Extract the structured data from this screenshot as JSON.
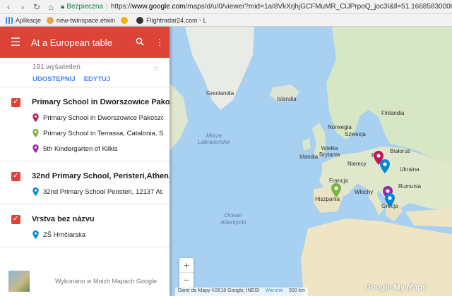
{
  "browser": {
    "secure_label": "Bezpieczna",
    "url_prefix": "https://",
    "url_host": "www.google.com",
    "url_rest": "/maps/d/u/0/viewer?mid=1aI8VkXrjhjGCFMuMR_CiJPrpoQ_joc3I&ll=51.166858300000015%2C19.093899498"
  },
  "bookmarks": [
    {
      "label": "Aplikacje",
      "color": "#5f6368"
    },
    {
      "label": "new-twinspace.etwin",
      "color": "#e8a33d"
    },
    {
      "label": "",
      "color": "#f4b400"
    },
    {
      "label": "Flightradar24.com - L",
      "color": "#333333"
    }
  ],
  "header": {
    "title": "At a European table"
  },
  "meta": {
    "views": "191 wyświetleń",
    "share_label": "UDOSTĘPNIJ",
    "edit_label": "EDYTUJ"
  },
  "layers": [
    {
      "title": "Primary School in Dworszowice Pako...",
      "places": [
        {
          "name": "Primary School in Dworszowice Pakoszo...",
          "color": "#c2185b"
        },
        {
          "name": "Primary School in Terrassa, Catalonia, S...",
          "color": "#7cb342"
        },
        {
          "name": "5th Kindergarten of Kilkis",
          "color": "#9c27b0"
        }
      ]
    },
    {
      "title": "32nd Primary School, Peristeri,Athen...",
      "places": [
        {
          "name": "32nd Primary School Peristeri, 12137 At...",
          "color": "#0288d1"
        }
      ]
    },
    {
      "title": "Vrstva bez názvu",
      "places": [
        {
          "name": "ZŠ Hrnčiarska",
          "color": "#0288d1"
        }
      ]
    }
  ],
  "footer": {
    "made_with": "Wykonano w Moich Mapach Google"
  },
  "map": {
    "labels": {
      "greenland": "Grenlandia",
      "iceland": "Islandia",
      "labrador": "Morze\nLabradorskie",
      "ocean": "Ocean\nAtlantycki",
      "norway": "Norwegia",
      "finland": "Finlandia",
      "sweden": "Szwecja",
      "uk": "Wielka\nBrytania",
      "ireland": "Irlandia",
      "germany": "Niemcy",
      "poland": "P",
      "belarus": "Białoruś",
      "ukraine": "Ukraina",
      "france": "Francja",
      "italy": "Włochy",
      "romania": "Rumunia",
      "spain": "Hiszpania",
      "greece": "Grecja"
    },
    "attribution": "Dane do Mapy ©2018 Google, INEGI",
    "terms": "Warunki",
    "scale": "500 km",
    "logo": "Google My Maps"
  }
}
